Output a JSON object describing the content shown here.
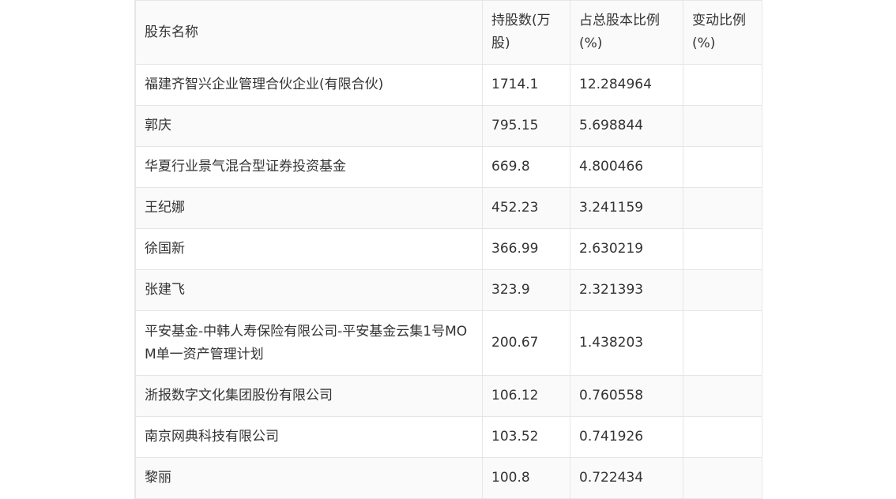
{
  "table": {
    "headers": [
      "股东名称",
      "持股数(万股)",
      "占总股本比例(%)",
      "变动比例(%)"
    ],
    "rows": [
      [
        "福建齐智兴企业管理合伙企业(有限合伙)",
        "1714.1",
        "12.284964",
        ""
      ],
      [
        "郭庆",
        "795.15",
        "5.698844",
        ""
      ],
      [
        "华夏行业景气混合型证券投资基金",
        "669.8",
        "4.800466",
        ""
      ],
      [
        "王纪娜",
        "452.23",
        "3.241159",
        ""
      ],
      [
        "徐国新",
        "366.99",
        "2.630219",
        ""
      ],
      [
        "张建飞",
        "323.9",
        "2.321393",
        ""
      ],
      [
        "平安基金-中韩人寿保险有限公司-平安基金云集1号MOM单一资产管理计划",
        "200.67",
        "1.438203",
        ""
      ],
      [
        "浙报数字文化集团股份有限公司",
        "106.12",
        "0.760558",
        ""
      ],
      [
        "南京网典科技有限公司",
        "103.52",
        "0.741926",
        ""
      ],
      [
        "黎丽",
        "100.8",
        "0.722434",
        ""
      ]
    ]
  }
}
